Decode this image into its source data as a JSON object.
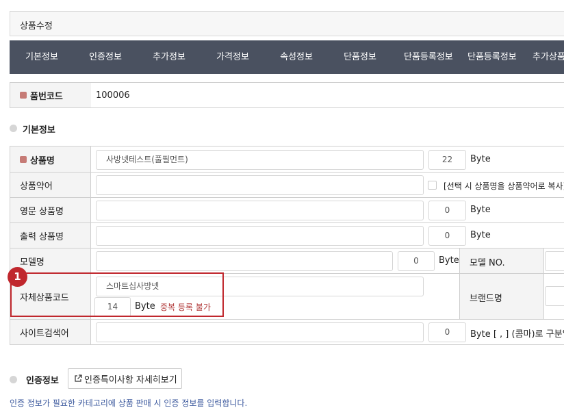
{
  "page": {
    "title": "상품수정"
  },
  "tabs": [
    "기본정보",
    "인증정보",
    "추가정보",
    "가격정보",
    "속성정보",
    "단품정보",
    "단품등록정보",
    "단품등록정보",
    "추가상품"
  ],
  "item_code": {
    "label": "품번코드",
    "value": "100006"
  },
  "basic_section": {
    "title": "기본정보"
  },
  "form": {
    "product_name": {
      "label": "상품명",
      "value": "사방넷테스트(풀필먼트)",
      "count": "22",
      "unit": "Byte"
    },
    "product_abbr": {
      "label": "상품약어",
      "value": "",
      "checkbox_label": "[선택 시 상품명을 상품약어로 복사]"
    },
    "english_name": {
      "label": "영문 상품명",
      "value": "",
      "count": "0",
      "unit": "Byte"
    },
    "print_name": {
      "label": "출력 상품명",
      "value": "",
      "count": "0",
      "unit": "Byte"
    },
    "model_name": {
      "label": "모델명",
      "value": "",
      "count": "0",
      "unit": "Byte",
      "model_no_label": "모델 NO."
    },
    "own_code": {
      "label": "자체상품코드",
      "value": "스마트십사방넷",
      "count": "14",
      "unit": "Byte",
      "warning": "중복 등록 불가",
      "brand_label": "브랜드명"
    },
    "site_keyword": {
      "label": "사이트검색어",
      "value": "",
      "count": "0",
      "unit_note": "Byte [ , ] (콤마)로 구분입력"
    }
  },
  "annotation": {
    "number": "1"
  },
  "cert_section": {
    "title": "인증정보",
    "detail_button": "인증특이사항 자세히보기",
    "notice": "인증 정보가 필요한 카테고리에 상품 판매 시 인증 정보를 입력합니다."
  },
  "colors": {
    "tab_bar": "#4a5160",
    "required_dot": "#c67b76",
    "annotation_red": "#c0272d",
    "warning_text": "#b23a3a",
    "notice_blue": "#3d5a9e"
  }
}
